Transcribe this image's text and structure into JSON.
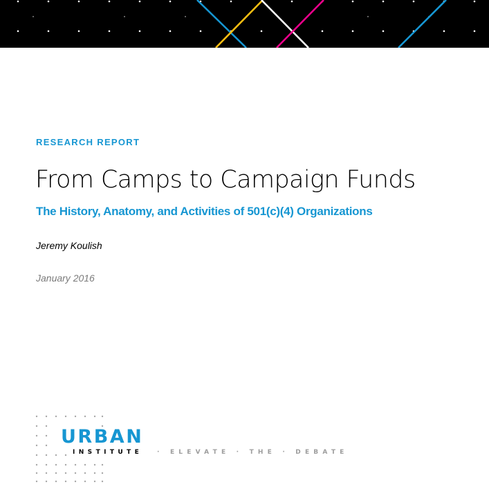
{
  "colors": {
    "brand_blue": "#1696d2",
    "accent_yellow": "#fdbf11",
    "accent_magenta": "#ec008b",
    "banner_black": "#000000",
    "date_gray": "#7a7a7a",
    "tagline_gray": "#9d9d9d"
  },
  "header": {
    "kicker": "RESEARCH REPORT",
    "title": "From Camps to Campaign Funds",
    "subtitle": "The History, Anatomy, and Activities of 501(c)(4) Organizations"
  },
  "byline": {
    "author": "Jeremy Koulish",
    "date": "January 2016"
  },
  "logo": {
    "wordmark": "URBAN",
    "subword": "INSTITUTE",
    "tagline": "· ELEVATE · THE · DEBATE"
  }
}
